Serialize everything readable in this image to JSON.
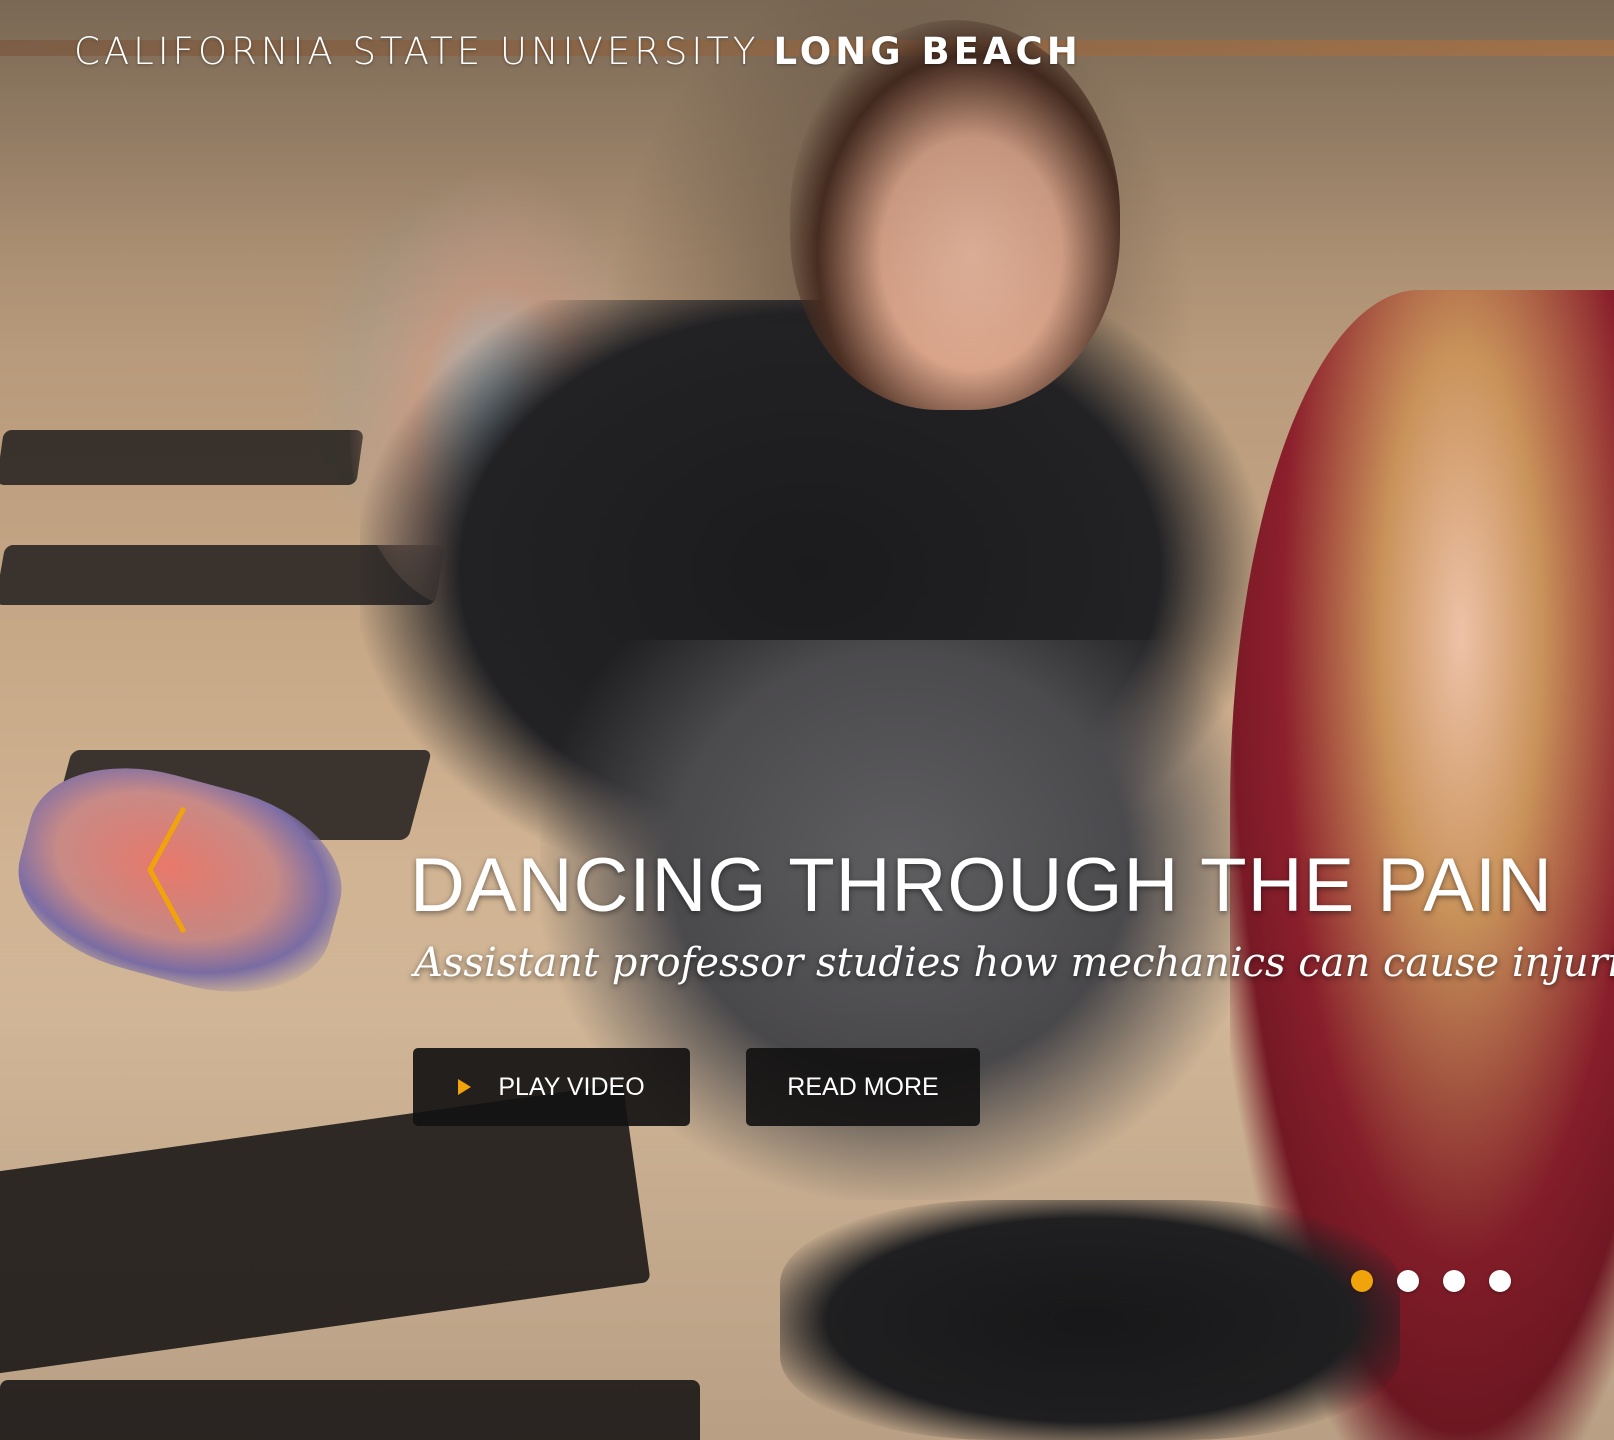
{
  "header": {
    "brand_light": "CALIFORNIA STATE UNIVERSITY",
    "brand_bold": "LONG BEACH"
  },
  "slide": {
    "headline": "DANCING THROUGH THE PAIN",
    "subheadline": "Assistant professor studies how mechanics can cause injuries",
    "buttons": {
      "play_video": "PLAY VIDEO",
      "read_more": "READ MORE"
    },
    "icons": {
      "prev": "chevron-left-icon",
      "play": "play-icon"
    }
  },
  "pager": {
    "count": 4,
    "active_index": 0
  },
  "colors": {
    "accent": "#f0a30a",
    "button_bg": "#141212",
    "text": "#ffffff"
  }
}
